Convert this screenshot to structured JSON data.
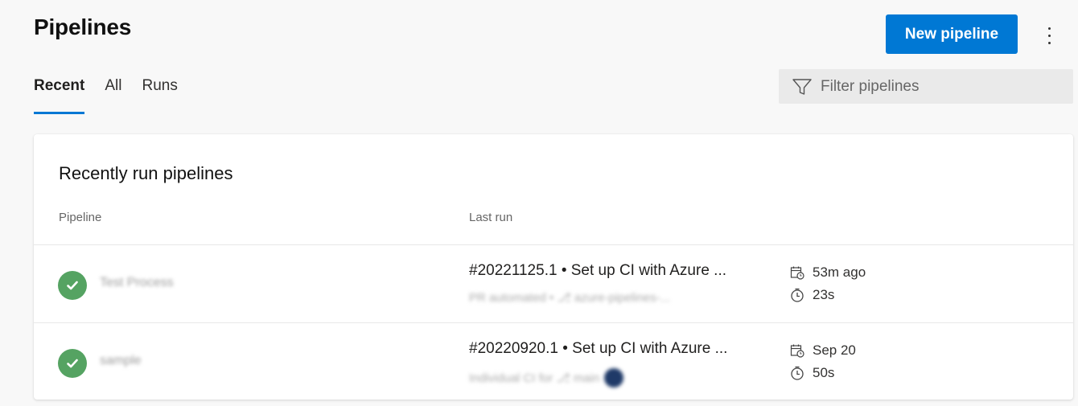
{
  "header": {
    "title": "Pipelines",
    "new_pipeline_label": "New pipeline",
    "more_actions_icon": "more-vertical-icon"
  },
  "tabs": [
    {
      "label": "Recent",
      "active": true
    },
    {
      "label": "All",
      "active": false
    },
    {
      "label": "Runs",
      "active": false
    }
  ],
  "filter": {
    "placeholder": "Filter pipelines",
    "value": "",
    "icon": "filter-icon"
  },
  "card": {
    "title": "Recently run pipelines",
    "columns": {
      "pipeline": "Pipeline",
      "last_run": "Last run"
    },
    "rows": [
      {
        "status": "succeeded",
        "status_icon": "check-circle-icon",
        "name": "Test Process",
        "run_title": "#20221125.1 • Set up CI with Azure ...",
        "run_subtitle": "PR automated • ⎇ azure-pipelines-...",
        "date": "53m ago",
        "duration": "23s"
      },
      {
        "status": "succeeded",
        "status_icon": "check-circle-icon",
        "name": "sample",
        "run_title": "#20220920.1 • Set up CI with Azure ...",
        "run_subtitle": "Individual CI for ⎇ main",
        "date": "Sep 20",
        "duration": "50s"
      }
    ]
  },
  "colors": {
    "accent": "#0078d4",
    "success": "#55a362",
    "background": "#f8f8f8",
    "card": "#ffffff"
  }
}
